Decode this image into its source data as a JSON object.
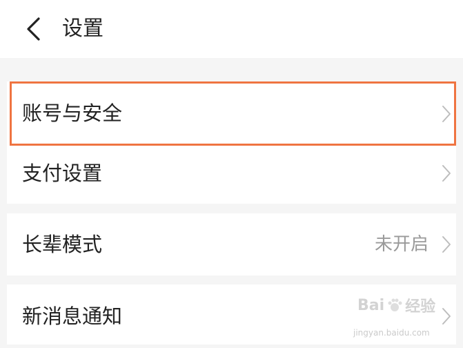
{
  "header": {
    "title": "设置"
  },
  "rows": [
    {
      "label": "账号与安全"
    },
    {
      "label": "支付设置"
    },
    {
      "label": "长辈模式",
      "value": "未开启"
    },
    {
      "label": "新消息通知"
    }
  ],
  "watermark": {
    "brand": "Bai",
    "brand2": "经验",
    "url": "jingyan.baidu.com"
  },
  "colors": {
    "highlight": "#ef7441",
    "background": "#f5f5f5",
    "text": "#222222",
    "secondary": "#9a9a9a"
  },
  "icons": {
    "back": "chevron-left-icon",
    "row_arrow": "chevron-right-icon"
  }
}
